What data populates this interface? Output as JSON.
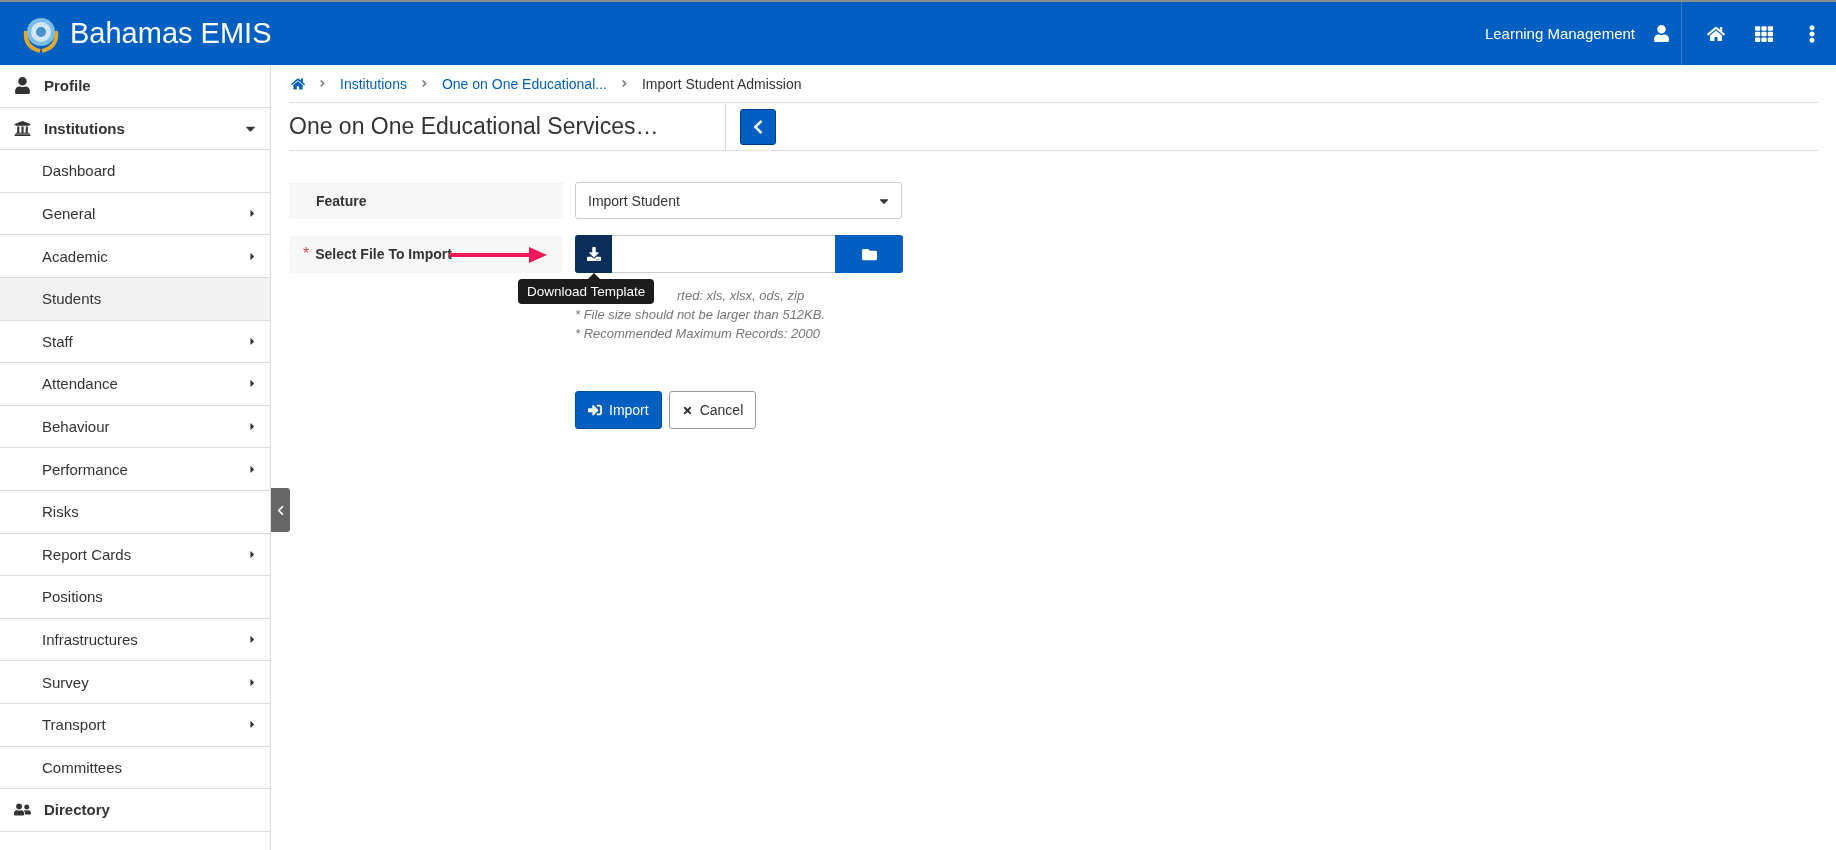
{
  "header": {
    "title": "Bahamas EMIS",
    "module": "Learning Management"
  },
  "sidebar": {
    "items": [
      {
        "label": "Profile"
      },
      {
        "label": "Institutions",
        "expanded": true,
        "children": [
          {
            "label": "Dashboard",
            "submenu": false,
            "selected": false
          },
          {
            "label": "General",
            "submenu": true,
            "selected": false
          },
          {
            "label": "Academic",
            "submenu": true,
            "selected": false
          },
          {
            "label": "Students",
            "submenu": false,
            "selected": true
          },
          {
            "label": "Staff",
            "submenu": true,
            "selected": false
          },
          {
            "label": "Attendance",
            "submenu": true,
            "selected": false
          },
          {
            "label": "Behaviour",
            "submenu": true,
            "selected": false
          },
          {
            "label": "Performance",
            "submenu": true,
            "selected": false
          },
          {
            "label": "Risks",
            "submenu": false,
            "selected": false
          },
          {
            "label": "Report Cards",
            "submenu": true,
            "selected": false
          },
          {
            "label": "Positions",
            "submenu": false,
            "selected": false
          },
          {
            "label": "Infrastructures",
            "submenu": true,
            "selected": false
          },
          {
            "label": "Survey",
            "submenu": true,
            "selected": false
          },
          {
            "label": "Transport",
            "submenu": true,
            "selected": false
          },
          {
            "label": "Committees",
            "submenu": false,
            "selected": false
          }
        ]
      },
      {
        "label": "Directory"
      }
    ]
  },
  "breadcrumb": [
    "Institutions",
    "One on One Educational...",
    "Import Student Admission"
  ],
  "page_title": "One on One Educational Services…",
  "form": {
    "feature": {
      "label": "Feature",
      "value": "Import Student"
    },
    "file": {
      "label": "Select File To Import",
      "required_mark": "*",
      "tooltip": "Download Template"
    },
    "help": [
      "rted: xls, xlsx, ods, zip",
      "* File size should not be larger than 512KB.",
      "* Recommended Maximum Records: 2000"
    ],
    "buttons": [
      {
        "label": "Import",
        "kind": "primary"
      },
      {
        "label": "Cancel",
        "kind": "default"
      }
    ]
  }
}
